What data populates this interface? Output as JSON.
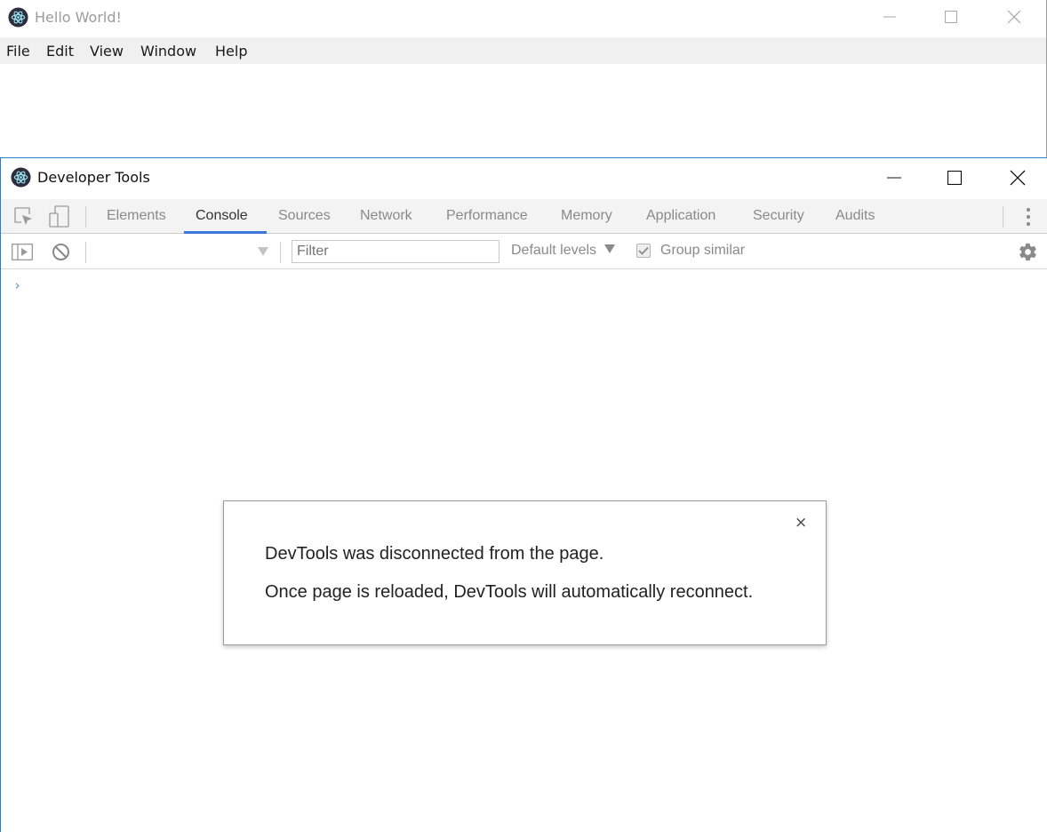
{
  "app_window": {
    "title": "Hello World!",
    "menu": [
      "File",
      "Edit",
      "View",
      "Window",
      "Help"
    ]
  },
  "devtools": {
    "title": "Developer Tools",
    "tabs": [
      "Elements",
      "Console",
      "Sources",
      "Network",
      "Performance",
      "Memory",
      "Application",
      "Security",
      "Audits"
    ],
    "active_tab": "Console",
    "console_toolbar": {
      "filter_placeholder": "Filter",
      "levels_label": "Default levels",
      "group_similar_label": "Group similar",
      "group_similar_checked": true
    },
    "prompt": "›"
  },
  "dialog": {
    "line1": "DevTools was disconnected from the page.",
    "line2": "Once page is reloaded, DevTools will automatically reconnect.",
    "close_glyph": "×"
  },
  "colors": {
    "accent_blue": "#3879d9",
    "window_border": "#2d7dc4",
    "tab_bar": "#f3f3f3",
    "menu_bar": "#f0f0f0"
  },
  "icons": [
    "electron-logo-icon",
    "minimize-icon",
    "maximize-icon",
    "close-icon",
    "inspect-element-icon",
    "device-toolbar-icon",
    "more-options-icon",
    "show-sidebar-icon",
    "clear-console-icon",
    "context-dropdown-icon",
    "settings-gear-icon",
    "check-icon"
  ]
}
